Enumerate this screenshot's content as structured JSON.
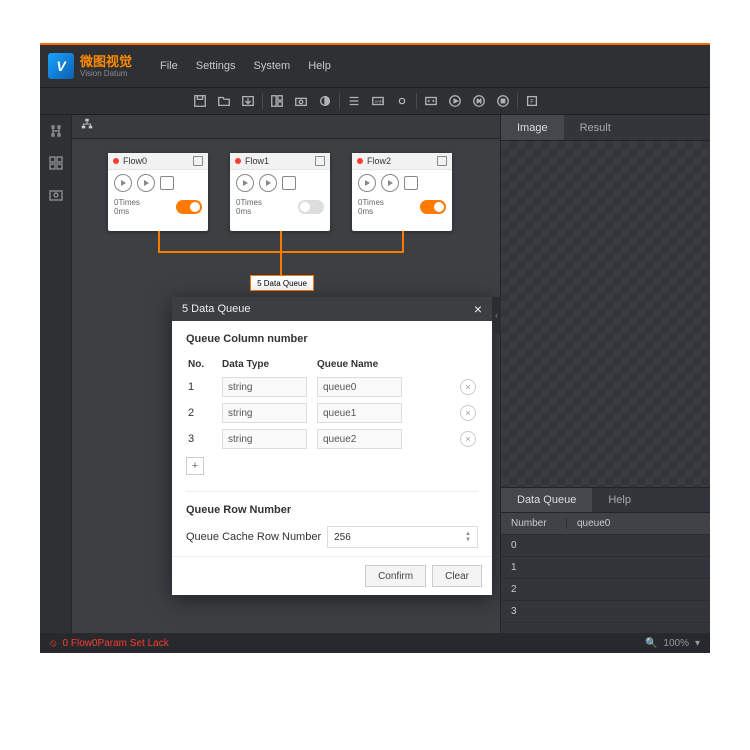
{
  "brand": {
    "name": "微图视觉",
    "sub": "Vision Datum",
    "mark": "V"
  },
  "menu": {
    "file": "File",
    "settings": "Settings",
    "system": "System",
    "help": "Help"
  },
  "flows": [
    {
      "name": "Flow0",
      "times": "0Times",
      "ms": "0ms",
      "toggle": "on"
    },
    {
      "name": "Flow1",
      "times": "0Times",
      "ms": "0ms",
      "toggle": "off"
    },
    {
      "name": "Flow2",
      "times": "0Times",
      "ms": "0ms",
      "toggle": "on"
    }
  ],
  "dq_node": "5 Data Queue",
  "dialog": {
    "title": "5 Data Queue",
    "section1": "Queue Column number",
    "headers": {
      "no": "No.",
      "type": "Data Type",
      "name": "Queue Name"
    },
    "rows": [
      {
        "no": "1",
        "type": "string",
        "name": "queue0"
      },
      {
        "no": "2",
        "type": "string",
        "name": "queue1"
      },
      {
        "no": "3",
        "type": "string",
        "name": "queue2"
      }
    ],
    "section2": "Queue Row Number",
    "cache_label": "Queue Cache Row Number",
    "cache_value": "256",
    "confirm": "Confirm",
    "clear": "Clear"
  },
  "right": {
    "tab_image": "Image",
    "tab_result": "Result",
    "tab_dq": "Data Queue",
    "tab_help": "Help",
    "col_num": "Number",
    "col_q": "queue0",
    "rows": [
      "0",
      "1",
      "2",
      "3"
    ]
  },
  "status": {
    "msg": "0 Flow0Param Set Lack",
    "zoom": "100%"
  }
}
